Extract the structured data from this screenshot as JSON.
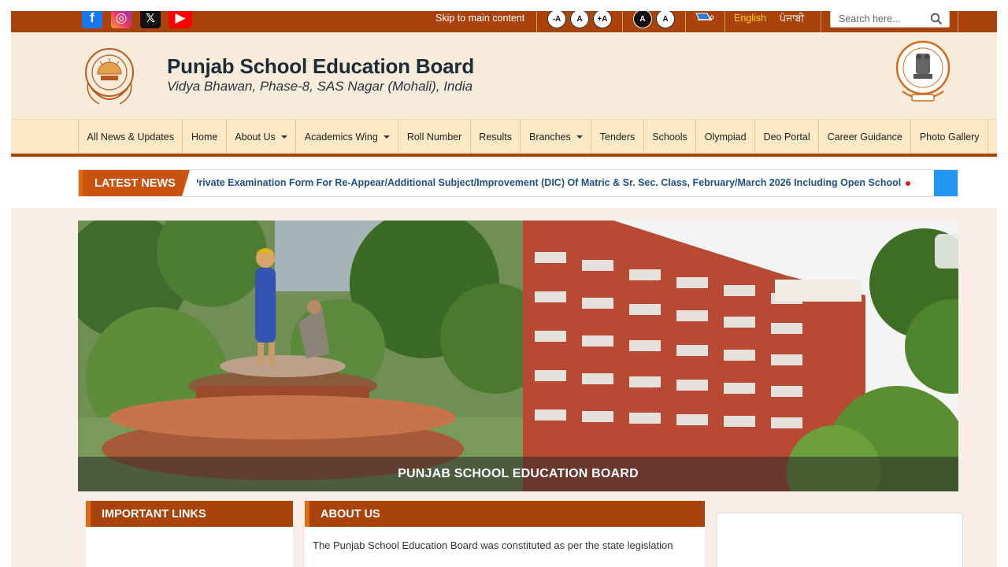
{
  "topbar": {
    "social": {
      "facebook": "f",
      "instagram": "◎",
      "x": "𝕏",
      "youtube": "▶"
    },
    "skip_link": "Skip to main content",
    "font_controls": [
      "-A",
      "A",
      "+A"
    ],
    "contrast_controls": [
      "A",
      "A"
    ],
    "lang_english": "English",
    "lang_punjabi": "ਪੰਜਾਬੀ",
    "search_placeholder": "Search here..."
  },
  "header": {
    "title": "Punjab School Education Board",
    "subtitle": "Vidya Bhawan, Phase-8, SAS Nagar (Mohali), India"
  },
  "nav": {
    "items": [
      {
        "label": "All News & Updates"
      },
      {
        "label": "Home"
      },
      {
        "label": "About Us"
      },
      {
        "label": "Academics Wing"
      },
      {
        "label": "Roll Number"
      },
      {
        "label": "Results"
      },
      {
        "label": "Branches"
      },
      {
        "label": "Tenders"
      },
      {
        "label": "Schools"
      },
      {
        "label": "Olympiad"
      },
      {
        "label": "Deo Portal"
      },
      {
        "label": "Career Guidance"
      },
      {
        "label": "Photo Gallery"
      }
    ]
  },
  "news": {
    "label": "LATEST NEWS",
    "ticker": "Private Examination Form For Re-Appear/Additional Subject/Improvement (DIC) Of Matric & Sr. Sec. Class, February/March 2026 Including Open School"
  },
  "banner": {
    "caption": "PUNJAB SCHOOL EDUCATION BOARD"
  },
  "sections": {
    "important_links": "IMPORTANT LINKS",
    "about": "ABOUT US",
    "about_text": "The Punjab School Education Board was constituted as per the state legislation"
  },
  "colors": {
    "brand": "#a9430b",
    "accent": "#e06a12",
    "nav_bg": "#fbeac5",
    "news_link": "#1f4e8a"
  }
}
